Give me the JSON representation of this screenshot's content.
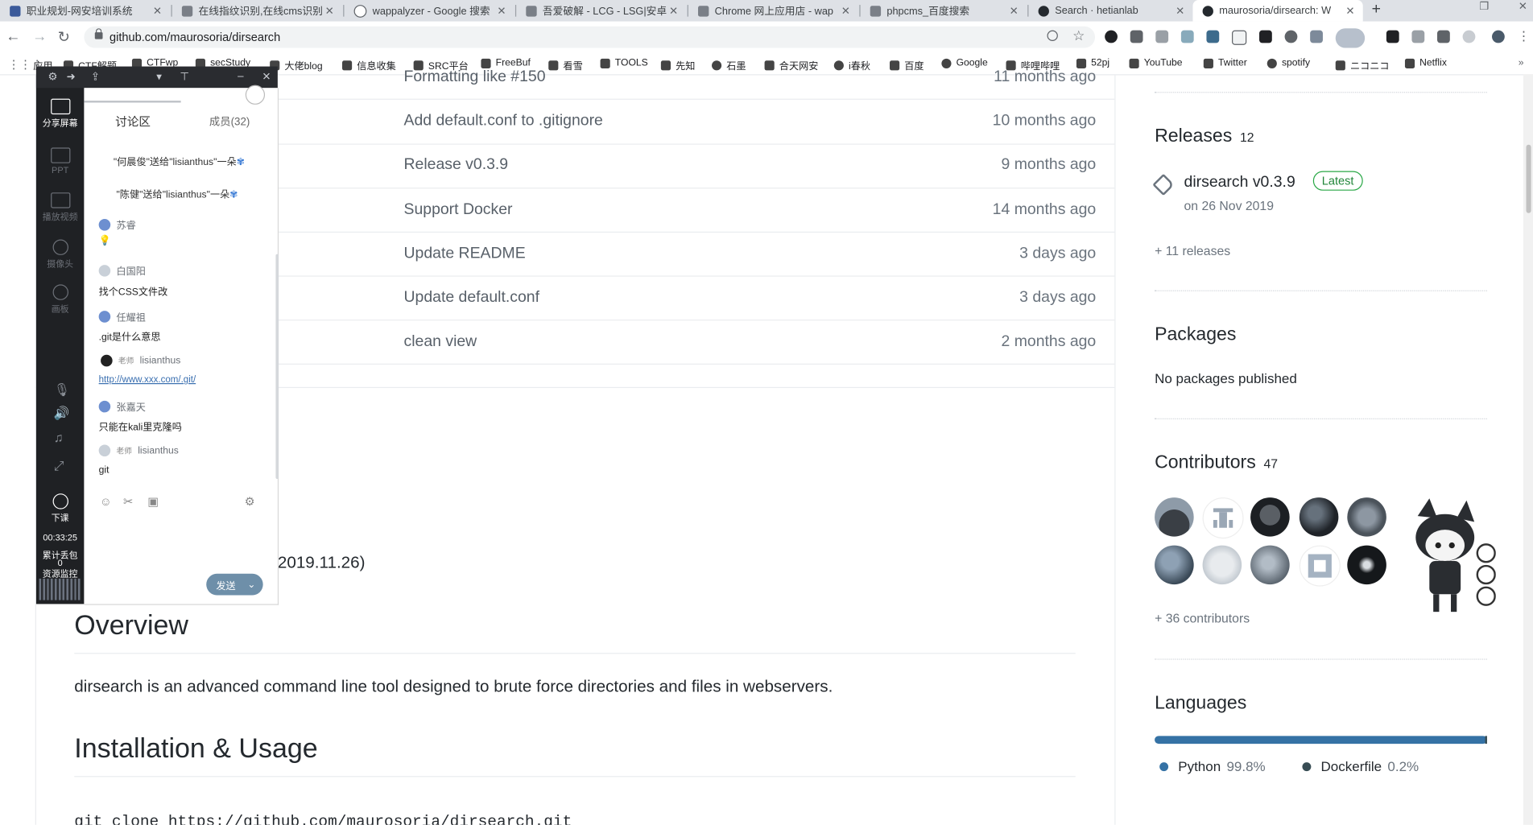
{
  "browser": {
    "tabs": [
      {
        "label": "职业规划-网安培训系统"
      },
      {
        "label": "在线指纹识别,在线cms识别"
      },
      {
        "label": "wappalyzer - Google 搜索"
      },
      {
        "label": "吾爱破解 - LCG - LSG|安卓"
      },
      {
        "label": "Chrome 网上应用店 - wap"
      },
      {
        "label": "phpcms_百度搜索"
      },
      {
        "label": "Search · hetianlab"
      },
      {
        "label": "maurosoria/dirsearch: W"
      }
    ],
    "new_tab_label": "+",
    "url": "github.com/maurosoria/dirsearch",
    "bookmarks": [
      "应用",
      "CTF解题",
      "CTFwp",
      "secStudy",
      "大佬blog",
      "信息收集",
      "SRC平台",
      "FreeBuf",
      "看雪",
      "TOOLS",
      "先知",
      "石墨",
      "合天网安",
      "i春秋",
      "百度",
      "Google",
      "哔哩哔哩",
      "52pj",
      "YouTube",
      "Twitter",
      "spotify",
      "ニコニコ",
      "Netflix"
    ]
  },
  "commits": [
    {
      "message": "Formatting like #150",
      "time": "11 months ago"
    },
    {
      "message": "Add default.conf to .gitignore",
      "time": "10 months ago"
    },
    {
      "message": "Release v0.3.9",
      "time": "9 months ago"
    },
    {
      "message": "Support Docker",
      "time": "14 months ago"
    },
    {
      "message": "Update README",
      "time": "3 days ago"
    },
    {
      "message": "Update default.conf",
      "time": "3 days ago"
    },
    {
      "message": "clean view",
      "time": "2 months ago"
    }
  ],
  "readme": {
    "version_fragment": "2019.11.26)",
    "overview_heading": "Overview",
    "description": "dirsearch is an advanced command line tool designed to brute force directories and files in webservers.",
    "install_heading": "Installation & Usage",
    "code_line": "git clone https://github.com/maurosoria/dirsearch.git"
  },
  "sidebar": {
    "releases": {
      "heading": "Releases",
      "count": "12",
      "name": "dirsearch v0.3.9",
      "badge": "Latest",
      "date": "on 26 Nov 2019",
      "more": "+ 11 releases"
    },
    "packages": {
      "heading": "Packages",
      "text": "No packages published"
    },
    "contributors": {
      "heading": "Contributors",
      "count": "47",
      "more": "+ 36 contributors"
    },
    "languages": {
      "heading": "Languages",
      "items": [
        {
          "name": "Python",
          "pct": "99.8%",
          "share": 0.998,
          "color": "#3572A5"
        },
        {
          "name": "Dockerfile",
          "pct": "0.2%",
          "share": 0.002,
          "color": "#384d54"
        }
      ]
    }
  },
  "chat": {
    "dock": {
      "share": "分享屏幕",
      "ppt": "PPT",
      "play": "播放视频",
      "camera": "摄像头",
      "board": "画板",
      "leave": "下课",
      "timer": "00:33:25",
      "stats1": "累计丢包",
      "stats2": "0",
      "stats3": "资源监控"
    },
    "tabs": {
      "discussion": "讨论区",
      "members": "成员(32)"
    },
    "gifts": [
      "\"何晨俊\"送给\"lisianthus\"一朵",
      "\"陈健\"送给\"lisianthus\"一朵"
    ],
    "messages": [
      {
        "user": "苏睿",
        "text": "💡"
      },
      {
        "user": "白国阳",
        "text": "找个CSS文件改"
      },
      {
        "user": "任耀祖",
        "text": ".git是什么意思"
      },
      {
        "user": "lisianthus",
        "role": "老师",
        "text": "http://www.xxx.com/.git/"
      },
      {
        "user": "张嘉天",
        "text": "只能在kali里克隆吗"
      },
      {
        "user": "lisianthus",
        "role": "老师",
        "text": "git"
      }
    ],
    "send_label": "发送"
  }
}
